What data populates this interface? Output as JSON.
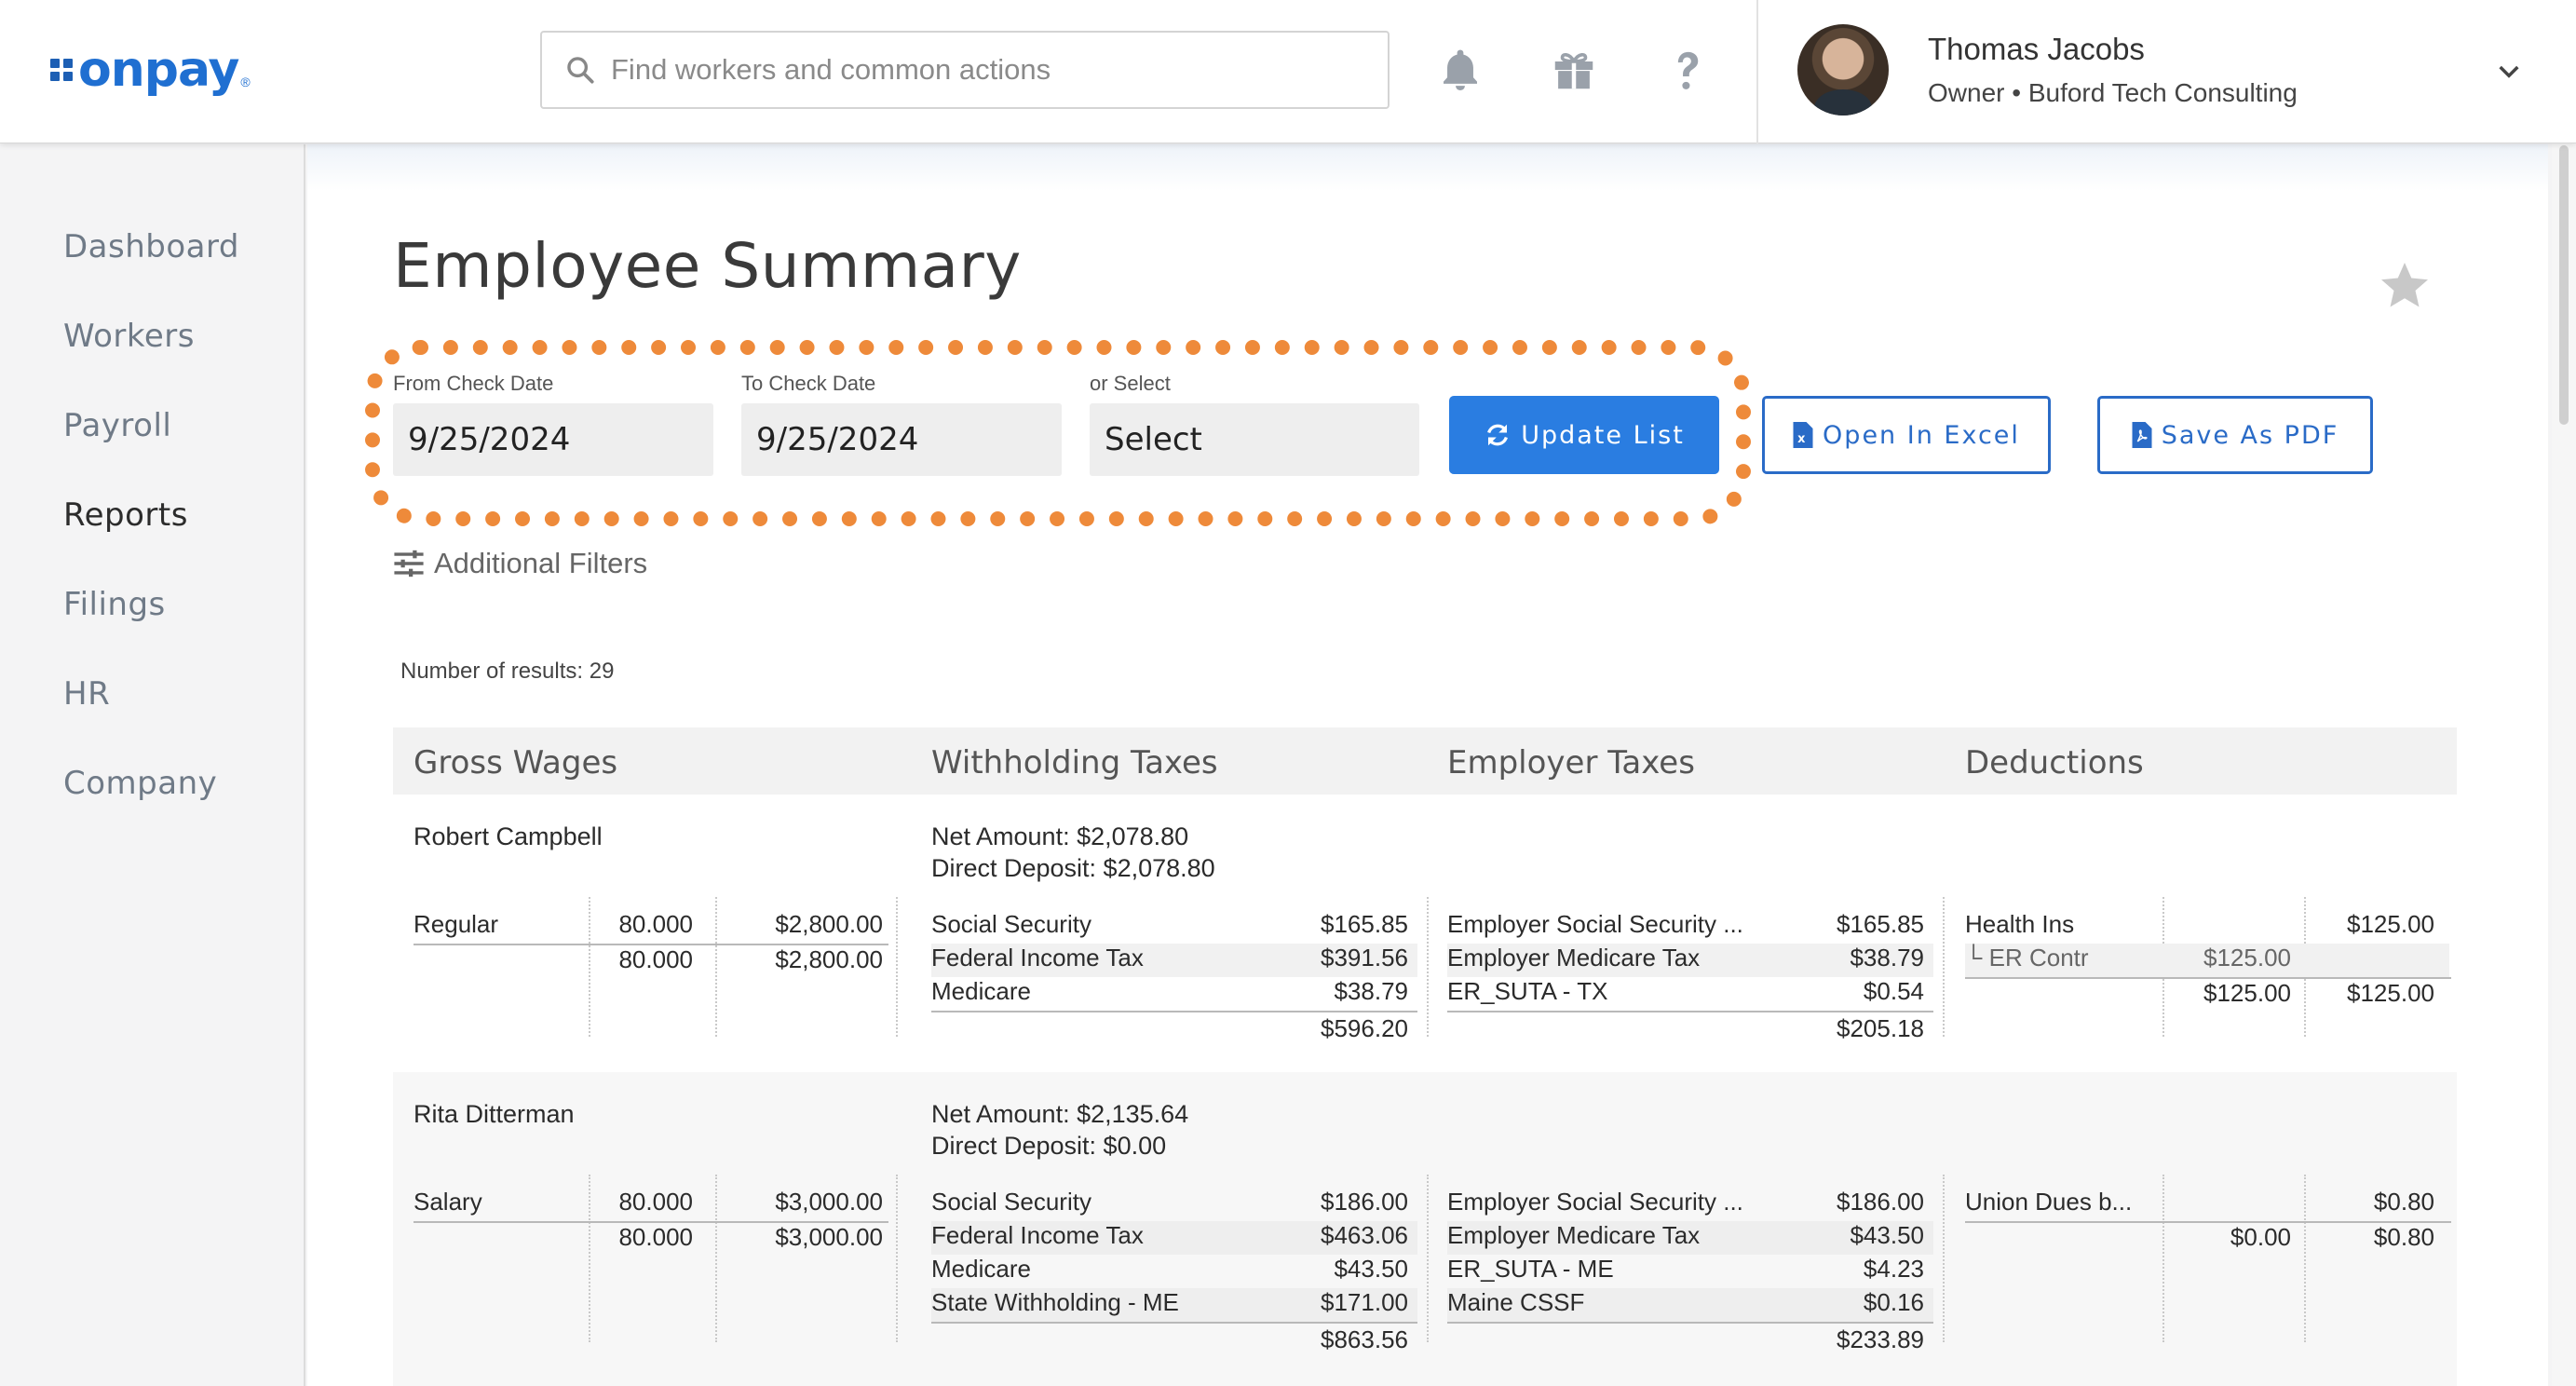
{
  "header": {
    "logo_text": "onpay",
    "logo_reg": "®",
    "search_placeholder": "Find workers and common actions",
    "icons": [
      "bell-icon",
      "gift-icon",
      "help-icon"
    ],
    "user": {
      "name": "Thomas Jacobs",
      "role": "Owner • Buford Tech Consulting"
    }
  },
  "sidebar": {
    "items": [
      {
        "label": "Dashboard",
        "active": false
      },
      {
        "label": "Workers",
        "active": false
      },
      {
        "label": "Payroll",
        "active": false
      },
      {
        "label": "Reports",
        "active": true
      },
      {
        "label": "Filings",
        "active": false
      },
      {
        "label": "HR",
        "active": false
      },
      {
        "label": "Company",
        "active": false
      }
    ]
  },
  "page": {
    "title": "Employee Summary",
    "from_label": "From Check Date",
    "from_value": "9/25/2024",
    "to_label": "To Check Date",
    "to_value": "9/25/2024",
    "select_label": "or Select",
    "select_value": "Select",
    "update_button": "Update List",
    "excel_button": "Open In Excel",
    "pdf_button": "Save As PDF",
    "filters_label": "Additional Filters",
    "results_text": "Number of results: 29"
  },
  "colors": {
    "accent": "#2a7de1",
    "highlight": "#ee8a3a",
    "brand": "#1f6fd1"
  },
  "table": {
    "headers": [
      "Gross Wages",
      "Withholding Taxes",
      "Employer Taxes",
      "Deductions"
    ],
    "employees": [
      {
        "name": "Robert Campbell",
        "net_amount": "Net Amount: $2,078.80",
        "direct_deposit": "Direct Deposit: $2,078.80",
        "wages": [
          {
            "type": "Regular",
            "hours": "80.000",
            "amount": "$2,800.00"
          }
        ],
        "wages_total": {
          "hours": "80.000",
          "amount": "$2,800.00"
        },
        "withholding": [
          {
            "name": "Social Security",
            "amount": "$165.85"
          },
          {
            "name": "Federal Income Tax",
            "amount": "$391.56"
          },
          {
            "name": "Medicare",
            "amount": "$38.79"
          }
        ],
        "withholding_total": "$596.20",
        "employer": [
          {
            "name": "Employer Social Security ...",
            "amount": "$165.85"
          },
          {
            "name": "Employer Medicare Tax",
            "amount": "$38.79"
          },
          {
            "name": "ER_SUTA - TX",
            "amount": "$0.54"
          }
        ],
        "employer_total": "$205.18",
        "deductions": [
          {
            "name": "Health Ins",
            "er": "",
            "amount": "$125.00"
          },
          {
            "name": "└ ER Contr",
            "er": "$125.00",
            "amount": ""
          }
        ],
        "deductions_total": {
          "er": "$125.00",
          "amount": "$125.00"
        }
      },
      {
        "name": "Rita Ditterman",
        "net_amount": "Net Amount: $2,135.64",
        "direct_deposit": "Direct Deposit: $0.00",
        "wages": [
          {
            "type": "Salary",
            "hours": "80.000",
            "amount": "$3,000.00"
          }
        ],
        "wages_total": {
          "hours": "80.000",
          "amount": "$3,000.00"
        },
        "withholding": [
          {
            "name": "Social Security",
            "amount": "$186.00"
          },
          {
            "name": "Federal Income Tax",
            "amount": "$463.06"
          },
          {
            "name": "Medicare",
            "amount": "$43.50"
          },
          {
            "name": "State Withholding - ME",
            "amount": "$171.00"
          }
        ],
        "withholding_total": "$863.56",
        "employer": [
          {
            "name": "Employer Social Security ...",
            "amount": "$186.00"
          },
          {
            "name": "Employer Medicare Tax",
            "amount": "$43.50"
          },
          {
            "name": "ER_SUTA - ME",
            "amount": "$4.23"
          },
          {
            "name": "Maine CSSF",
            "amount": "$0.16"
          }
        ],
        "employer_total": "$233.89",
        "deductions": [
          {
            "name": "Union Dues b...",
            "er": "",
            "amount": "$0.80"
          }
        ],
        "deductions_total": {
          "er": "$0.00",
          "amount": "$0.80"
        }
      }
    ]
  }
}
